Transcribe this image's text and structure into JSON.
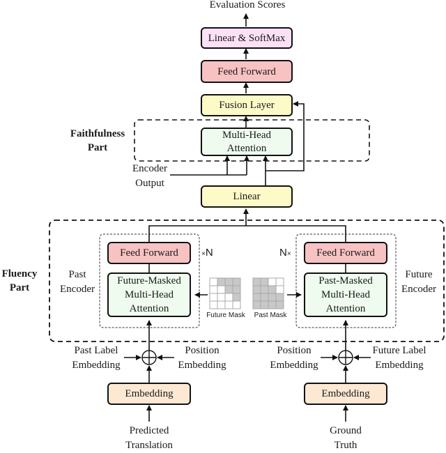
{
  "title": "Evaluation Scores",
  "colors": {
    "pink_light": "#fbe0f6",
    "red_light": "#f8c2c2",
    "yellow_light": "#fcfac6",
    "green_light": "#eefbee",
    "peach_light": "#fde9d3",
    "mask_gray": "#c8c8c8",
    "mask_white": "#ffffff"
  },
  "top": {
    "output_label": "Evaluation Scores",
    "linear_softmax": "Linear & SoftMax",
    "feed_forward": "Feed Forward",
    "fusion_layer": "Fusion Layer"
  },
  "faithfulness": {
    "part_label_line1": "Faithfulness",
    "part_label_line2": "Part",
    "attention_line1": "Multi-Head",
    "attention_line2": "Attention",
    "encoder_output_line1": "Encoder",
    "encoder_output_line2": "Output"
  },
  "linear": "Linear",
  "fluency": {
    "part_label_line1": "Fluency",
    "part_label_line2": "Part",
    "past_encoder": {
      "label_line1": "Past",
      "label_line2": "Encoder",
      "feed_forward": "Feed Forward",
      "attention_line1": "Future-Masked",
      "attention_line2": "Multi-Head",
      "attention_line3": "Attention",
      "repeat_prefix": "×",
      "repeat_n": "N"
    },
    "future_encoder": {
      "label_line1": "Future",
      "label_line2": "Encoder",
      "feed_forward": "Feed Forward",
      "attention_line1": "Past-Masked",
      "attention_line2": "Multi-Head",
      "attention_line3": "Attention",
      "repeat_n": "N",
      "repeat_suffix": "×"
    },
    "future_mask": {
      "label": "Future Mask",
      "grid": [
        [
          0,
          1,
          1,
          1
        ],
        [
          0,
          0,
          1,
          1
        ],
        [
          0,
          0,
          0,
          1
        ],
        [
          0,
          0,
          0,
          0
        ]
      ]
    },
    "past_mask": {
      "label": "Past Mask",
      "grid": [
        [
          1,
          1,
          0,
          0
        ],
        [
          1,
          1,
          1,
          0
        ],
        [
          1,
          1,
          1,
          1
        ],
        [
          1,
          1,
          1,
          1
        ]
      ]
    }
  },
  "bottom_left": {
    "past_label_line1": "Past Label",
    "past_label_line2": "Embedding",
    "position_line1": "Position",
    "position_line2": "Embedding",
    "embedding": "Embedding",
    "input_line1": "Predicted",
    "input_line2": "Translation"
  },
  "bottom_right": {
    "position_line1": "Position",
    "position_line2": "Embedding",
    "future_label_line1": "Future Label",
    "future_label_line2": "Embedding",
    "embedding": "Embedding",
    "input_line1": "Ground",
    "input_line2": "Truth"
  }
}
